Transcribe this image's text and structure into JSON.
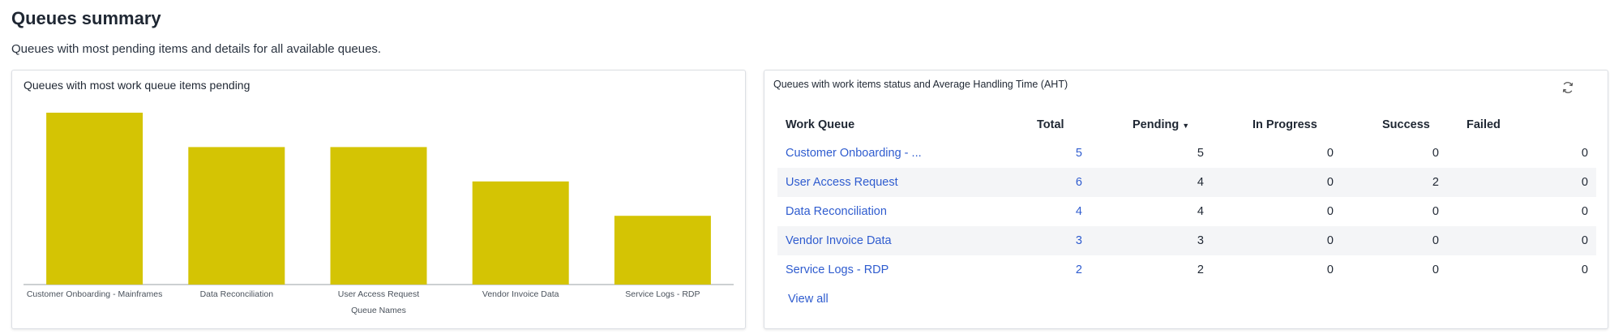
{
  "header": {
    "title": "Queues summary",
    "subtitle": "Queues with most pending items and details for all available queues."
  },
  "chart_card": {
    "title": "Queues with most work queue items pending"
  },
  "chart_data": {
    "type": "bar",
    "categories": [
      "Customer Onboarding - Mainframes",
      "Data Reconciliation",
      "User Access Request",
      "Vendor Invoice Data",
      "Service Logs - RDP"
    ],
    "values": [
      5,
      4,
      4,
      3,
      2
    ],
    "xlabel": "Queue Names",
    "ylabel": "",
    "ylim": [
      0,
      5
    ],
    "grid": false,
    "bar_color": "#d4c404"
  },
  "table_card": {
    "title": "Queues with work items status and Average Handling Time (AHT)",
    "refresh_icon": "refresh-icon",
    "columns": [
      "Work Queue",
      "Total",
      "Pending",
      "In Progress",
      "Success",
      "Failed"
    ],
    "sort_icon": "caret-down-icon",
    "rows": [
      {
        "name": "Customer Onboarding - ...",
        "total": "5",
        "pending": "5",
        "in_progress": "0",
        "success": "0",
        "failed": "0"
      },
      {
        "name": "User Access Request",
        "total": "6",
        "pending": "4",
        "in_progress": "0",
        "success": "2",
        "failed": "0"
      },
      {
        "name": "Data Reconciliation",
        "total": "4",
        "pending": "4",
        "in_progress": "0",
        "success": "0",
        "failed": "0"
      },
      {
        "name": "Vendor Invoice Data",
        "total": "3",
        "pending": "3",
        "in_progress": "0",
        "success": "0",
        "failed": "0"
      },
      {
        "name": "Service Logs - RDP",
        "total": "2",
        "pending": "2",
        "in_progress": "0",
        "success": "0",
        "failed": "0"
      }
    ],
    "view_all": "View all",
    "link_color": "#2f5ccf"
  }
}
